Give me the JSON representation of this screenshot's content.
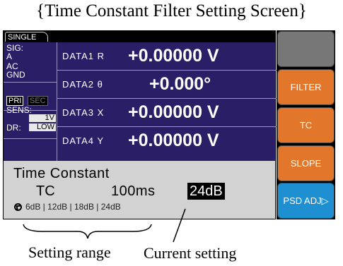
{
  "captions": {
    "top": "{Time Constant Filter Setting Screen}",
    "setting_range": "Setting range",
    "current_setting": "Current setting"
  },
  "screen": {
    "mode_tab": "SINGLE",
    "status": {
      "sig_label": "SIG:",
      "sig_value1": "A",
      "sig_value2": "AC",
      "sig_value3": "GND",
      "pri_label": "PRI",
      "sec_label": "SEC",
      "sens_label": "SENS:",
      "sens_value": "1V",
      "dr_label": "DR:",
      "dr_value": "LOW"
    },
    "rows": [
      {
        "label": "DATA1  R",
        "value": "+0.00000  V"
      },
      {
        "label": "DATA2  θ",
        "value": "+0.000°"
      },
      {
        "label": "DATA3  X",
        "value": "+0.00000  V"
      },
      {
        "label": "DATA4  Y",
        "value": "+0.00000  V"
      }
    ],
    "time_constant": {
      "title": "Time Constant",
      "tc_label": "TC",
      "tc_value": "100ms",
      "slope_current": "24dB",
      "range_options": "6dB | 12dB | 18dB | 24dB"
    },
    "softkeys": [
      "",
      "FILTER",
      "TC",
      "SLOPE",
      "PSD ADJ▷"
    ]
  },
  "colors": {
    "screen_bg": "#2a1e66",
    "softkey_orange": "#e2762b",
    "softkey_blue": "#1e8fd1",
    "softkey_blank": "#777777",
    "info_panel": "#d2d2d2"
  }
}
